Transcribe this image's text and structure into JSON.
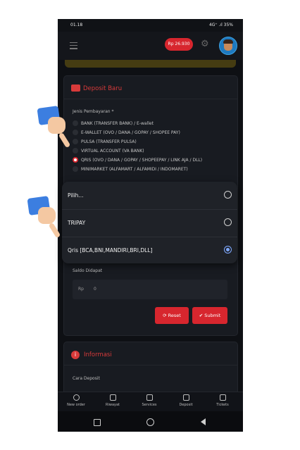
{
  "status_bar": {
    "time": "01.18",
    "indicators": "4G⁺ .ıl 35%"
  },
  "header": {
    "balance": "Rp 26.930",
    "menu_icon": "hamburger-icon",
    "settings_icon": "gear-icon"
  },
  "deposit": {
    "title": "Deposit Baru",
    "payment_type_label": "Jenis Pembayaran *",
    "payment_types": [
      {
        "label": "BANK (TRANSFER BANK) / E-wallet",
        "selected": false
      },
      {
        "label": "E-WALLET (OVO / DANA / GOPAY / SHOPEE PAY)",
        "selected": false
      },
      {
        "label": "PULSA (TRANSFER PULSA)",
        "selected": false
      },
      {
        "label": "VIRTUAL ACCOUNT (VA BANK)",
        "selected": false
      },
      {
        "label": "QRIS (OVO / DANA / GOPAY / SHOPEEPAY / LINK AJA / DLL)",
        "selected": true
      },
      {
        "label": "MINIMARKET (ALFAMART / ALFAMIDI / INDOMARET)",
        "selected": false
      }
    ],
    "saldo_label": "Saldo Didapat",
    "currency": "Rp",
    "saldo_value": "0",
    "reset_label": "Reset",
    "submit_label": "Submit"
  },
  "dropdown": {
    "options": [
      {
        "label": "Pilih...",
        "selected": false
      },
      {
        "label": "TRIPAY",
        "selected": false
      },
      {
        "label": "Qris [BCA,BNI,MANDIRI,BRI,DLL]",
        "selected": true
      }
    ]
  },
  "info": {
    "title": "Informasi",
    "how_to": "Cara Deposit"
  },
  "bottom_nav": [
    "New order",
    "Riwayat",
    "Services",
    "Deposit",
    "Tickets"
  ],
  "colors": {
    "accent": "#d7262e",
    "radio_selected": "#7fa9ff",
    "background": "#0e1014"
  }
}
